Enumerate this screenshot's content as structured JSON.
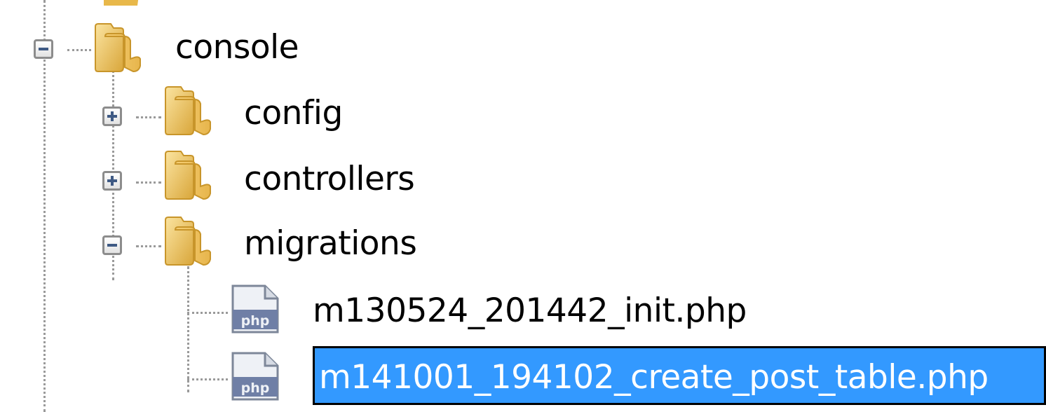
{
  "tree": {
    "root": {
      "label": "console",
      "expanded": true
    },
    "children": [
      {
        "label": "config",
        "type": "folder",
        "expanded": false
      },
      {
        "label": "controllers",
        "type": "folder",
        "expanded": false
      },
      {
        "label": "migrations",
        "type": "folder",
        "expanded": true
      }
    ],
    "files": [
      {
        "label": "m130524_201442_init.php",
        "type": "php",
        "selected": false
      },
      {
        "label": "m141001_194102_create_post_table.php",
        "type": "php",
        "selected": true
      }
    ],
    "icons": {
      "folder": "folder-icon",
      "php": "php-file-icon",
      "expand": "plus-expander-icon",
      "collapse": "minus-expander-icon"
    },
    "colors": {
      "selection": "#3399ff",
      "selection_text": "#ffffff",
      "expander_glyph": "#3f5a84"
    }
  }
}
